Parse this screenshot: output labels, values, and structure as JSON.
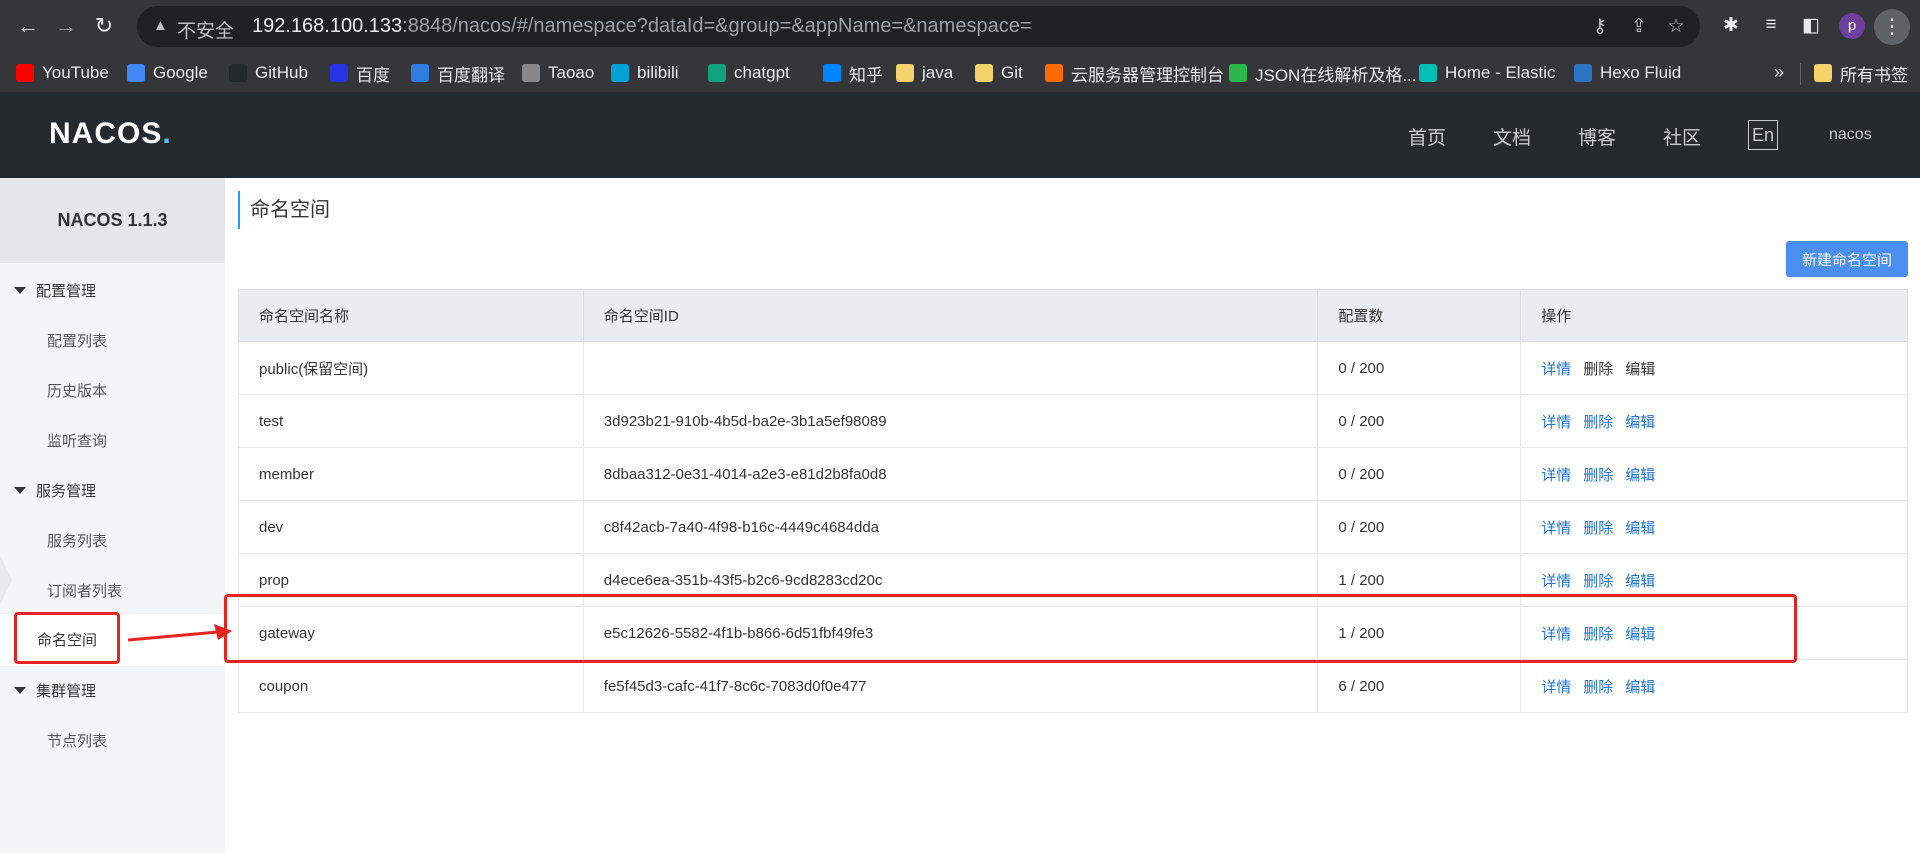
{
  "browser": {
    "insecure_label": "不安全",
    "url_host": "192.168.100.133",
    "url_rest": ":8848/nacos/#/namespace?dataId=&group=&appName=&namespace=",
    "profile_initial": "p",
    "bookmarks": [
      {
        "label": "YouTube",
        "icon": "youtube-icon",
        "color": "#ff0000"
      },
      {
        "label": "Google",
        "icon": "google-icon",
        "color": "#4285f4"
      },
      {
        "label": "GitHub",
        "icon": "github-icon",
        "color": "#24292e"
      },
      {
        "label": "百度",
        "icon": "baidu-icon",
        "color": "#2932e1"
      },
      {
        "label": "百度翻译",
        "icon": "baidu-translate-icon",
        "color": "#2f7de1"
      },
      {
        "label": "Taoao",
        "icon": "taoao-icon",
        "color": "#888888"
      },
      {
        "label": "bilibili",
        "icon": "bilibili-icon",
        "color": "#00a1d6"
      },
      {
        "label": "chatgpt",
        "icon": "chatgpt-icon",
        "color": "#10a37f"
      },
      {
        "label": "知乎",
        "icon": "zhihu-icon",
        "color": "#0084ff"
      },
      {
        "label": "java",
        "icon": "folder-icon",
        "color": "#f4d26b"
      },
      {
        "label": "Git",
        "icon": "folder-icon",
        "color": "#f4d26b"
      },
      {
        "label": "云服务器管理控制台",
        "icon": "aliyun-icon",
        "color": "#ff6a00"
      },
      {
        "label": "JSON在线解析及格...",
        "icon": "json-icon",
        "color": "#2db84d"
      },
      {
        "label": "Home - Elastic",
        "icon": "elastic-icon",
        "color": "#00bfb3"
      },
      {
        "label": "Hexo Fluid",
        "icon": "hexo-icon",
        "color": "#2f74c0"
      }
    ],
    "more_label": "»",
    "all_bookmarks_label": "所有书签"
  },
  "header": {
    "logo_text": "NACOS",
    "logo_dot": ".",
    "nav": [
      "首页",
      "文档",
      "博客",
      "社区"
    ],
    "lang": "En",
    "user": "nacos"
  },
  "sidebar": {
    "title": "NACOS 1.1.3",
    "groups": [
      {
        "label": "配置管理",
        "items": [
          "配置列表",
          "历史版本",
          "监听查询"
        ]
      },
      {
        "label": "服务管理",
        "items": [
          "服务列表",
          "订阅者列表",
          "命名空间"
        ]
      },
      {
        "label": "集群管理",
        "items": [
          "节点列表"
        ]
      }
    ],
    "active_item": "命名空间"
  },
  "main": {
    "title": "命名空间",
    "new_button": "新建命名空间",
    "columns": [
      "命名空间名称",
      "命名空间ID",
      "配置数",
      "操作"
    ],
    "rows": [
      {
        "name": "public(保留空间)",
        "id": "",
        "count": "0 / 200"
      },
      {
        "name": "test",
        "id": "3d923b21-910b-4b5d-ba2e-3b1a5ef98089",
        "count": "0 / 200"
      },
      {
        "name": "member",
        "id": "8dbaa312-0e31-4014-a2e3-e81d2b8fa0d8",
        "count": "0 / 200"
      },
      {
        "name": "dev",
        "id": "c8f42acb-7a40-4f98-b16c-4449c4684dda",
        "count": "0 / 200"
      },
      {
        "name": "prop",
        "id": "d4ece6ea-351b-43f5-b2c6-9cd8283cd20c",
        "count": "1 / 200"
      },
      {
        "name": "gateway",
        "id": "e5c12626-5582-4f1b-b866-6d51fbf49fe3",
        "count": "1 / 200"
      },
      {
        "name": "coupon",
        "id": "fe5f45d3-cafc-41f7-8c6c-7083d0f0e477",
        "count": "6 / 200"
      }
    ],
    "actions": {
      "detail": "详情",
      "delete": "删除",
      "edit": "编辑"
    }
  },
  "colors": {
    "accent": "#4a8eef",
    "link": "#1f74d8",
    "highlight": "#e52420",
    "header_bg": "#252a2f"
  }
}
